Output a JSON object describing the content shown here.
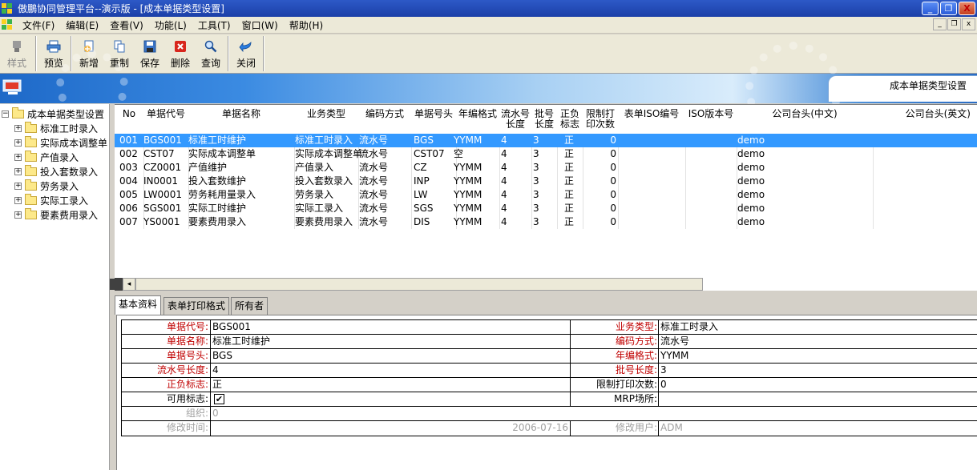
{
  "window": {
    "title": "傲鵬协同管理平台--演示版 - [成本单据类型设置]",
    "minimize": "_",
    "restore": "❐",
    "close": "X"
  },
  "menu": [
    "文件(F)",
    "编辑(E)",
    "查看(V)",
    "功能(L)",
    "工具(T)",
    "窗口(W)",
    "帮助(H)"
  ],
  "toolbar": {
    "style": {
      "label": "样式",
      "icon": "style-icon"
    },
    "preview": {
      "label": "预览",
      "icon": "printer-icon"
    },
    "add": {
      "label": "新增",
      "icon": "new-doc-icon"
    },
    "copy": {
      "label": "重制",
      "icon": "copy-icon"
    },
    "save": {
      "label": "保存",
      "icon": "floppy-icon"
    },
    "delete": {
      "label": "删除",
      "icon": "delete-icon"
    },
    "query": {
      "label": "查询",
      "icon": "magnifier-icon"
    },
    "close": {
      "label": "关闭",
      "icon": "return-arrow-icon"
    }
  },
  "banner": {
    "tab_title": "成本单据类型设置"
  },
  "tree": {
    "root": "成本单据类型设置",
    "items": [
      "标准工时录入",
      "实际成本调整单",
      "产值录入",
      "投入套数录入",
      "劳务录入",
      "实际工录入",
      "要素费用录入"
    ]
  },
  "grid": {
    "headers": {
      "no": "No",
      "code": "单据代号",
      "name": "单据名称",
      "biz_type": "业务类型",
      "encode": "编码方式",
      "prefix": "单据号头",
      "year_fmt": "年编格式",
      "serial_len_1": "流水号",
      "serial_len_2": "长度",
      "batch_len_1": "批号",
      "batch_len_2": "长度",
      "sign_1": "正负",
      "sign_2": "标志",
      "print_1": "限制打",
      "print_2": "印次数",
      "iso_code": "表单ISO编号",
      "iso_ver": "ISO版本号",
      "header_cn": "公司台头(中文)",
      "header_en": "公司台头(英文)"
    },
    "rows": [
      {
        "no": "001",
        "code": "BGS001",
        "name": "标准工时维护",
        "biz_type": "标准工时录入",
        "encode": "流水号",
        "prefix": "BGS",
        "year_fmt": "YYMM",
        "serial_len": "4",
        "batch_len": "3",
        "sign": "正",
        "print": "0",
        "header_cn": "demo"
      },
      {
        "no": "002",
        "code": "CST07",
        "name": "实际成本调整单",
        "biz_type": "实际成本调整单",
        "encode": "流水号",
        "prefix": "CST07",
        "year_fmt": "空",
        "serial_len": "4",
        "batch_len": "3",
        "sign": "正",
        "print": "0",
        "header_cn": "demo"
      },
      {
        "no": "003",
        "code": "CZ0001",
        "name": "产值维护",
        "biz_type": "产值录入",
        "encode": "流水号",
        "prefix": "CZ",
        "year_fmt": "YYMM",
        "serial_len": "4",
        "batch_len": "3",
        "sign": "正",
        "print": "0",
        "header_cn": "demo"
      },
      {
        "no": "004",
        "code": "IN0001",
        "name": "投入套数维护",
        "biz_type": "投入套数录入",
        "encode": "流水号",
        "prefix": "INP",
        "year_fmt": "YYMM",
        "serial_len": "4",
        "batch_len": "3",
        "sign": "正",
        "print": "0",
        "header_cn": "demo"
      },
      {
        "no": "005",
        "code": "LW0001",
        "name": "劳务耗用量录入",
        "biz_type": "劳务录入",
        "encode": "流水号",
        "prefix": "LW",
        "year_fmt": "YYMM",
        "serial_len": "4",
        "batch_len": "3",
        "sign": "正",
        "print": "0",
        "header_cn": "demo"
      },
      {
        "no": "006",
        "code": "SGS001",
        "name": "实际工时维护",
        "biz_type": "实际工录入",
        "encode": "流水号",
        "prefix": "SGS",
        "year_fmt": "YYMM",
        "serial_len": "4",
        "batch_len": "3",
        "sign": "正",
        "print": "0",
        "header_cn": "demo"
      },
      {
        "no": "007",
        "code": "YS0001",
        "name": "要素费用录入",
        "biz_type": "要素费用录入",
        "encode": "流水号",
        "prefix": "DIS",
        "year_fmt": "YYMM",
        "serial_len": "4",
        "batch_len": "3",
        "sign": "正",
        "print": "0",
        "header_cn": "demo"
      }
    ]
  },
  "tabs": [
    "基本资料",
    "表单打印格式",
    "所有者"
  ],
  "form": {
    "code_label": "单据代号:",
    "code": "BGS001",
    "biz_label": "业务类型:",
    "biz": "标准工时录入",
    "name_label": "单据名称:",
    "name": "标准工时维护",
    "encode_label": "编码方式:",
    "encode": "流水号",
    "prefix_label": "单据号头:",
    "prefix": "BGS",
    "year_label": "年编格式:",
    "year": "YYMM",
    "serial_label": "流水号长度:",
    "serial": "4",
    "batch_label": "批号长度:",
    "batch": "3",
    "sign_label": "正负标志:",
    "sign": "正",
    "print_label": "限制打印次数:",
    "print": "0",
    "enabled_label": "可用标志:",
    "enabled_check": "✔",
    "mrp_label": "MRP场所:",
    "mrp": "",
    "org_label": "组织:",
    "org": "0",
    "mtime_label": "修改时间:",
    "mtime": "2006-07-16",
    "muser_label": "修改用户:",
    "muser": "ADM"
  }
}
